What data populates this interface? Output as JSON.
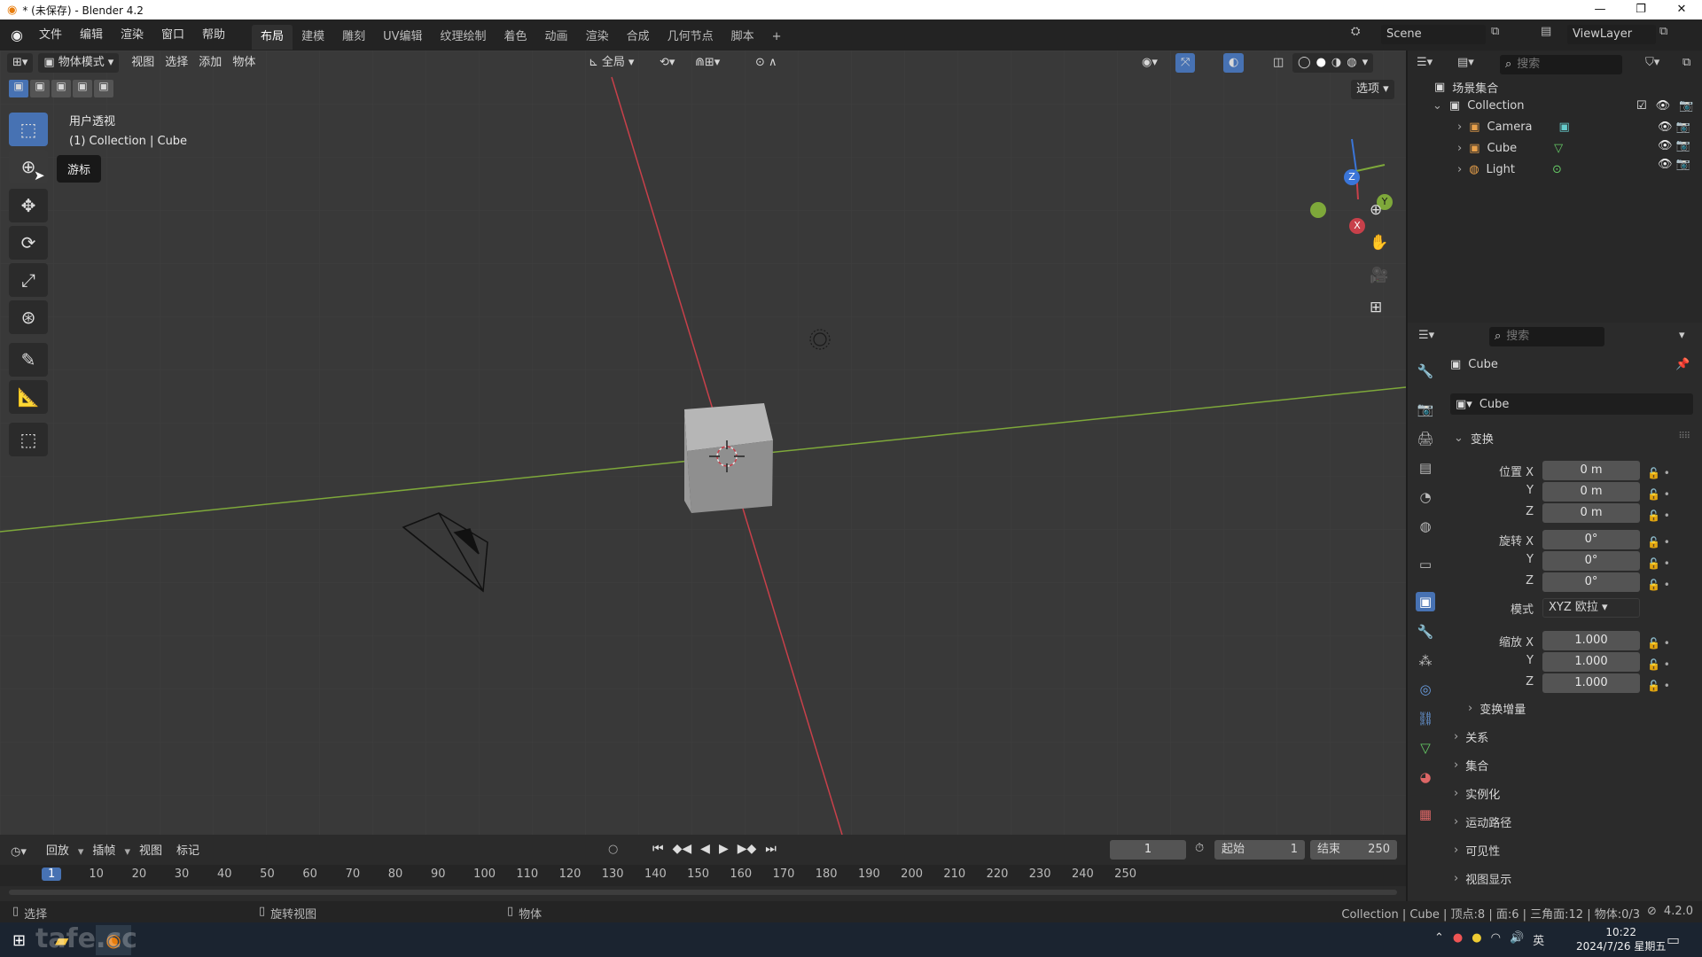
{
  "window": {
    "title": "* (未保存) - Blender 4.2",
    "min": "—",
    "max": "❐",
    "close": "✕"
  },
  "menu": {
    "items": [
      "文件",
      "编辑",
      "渲染",
      "窗口",
      "帮助"
    ]
  },
  "workspaces": {
    "tabs": [
      "布局",
      "建模",
      "雕刻",
      "UV编辑",
      "纹理绘制",
      "着色",
      "动画",
      "渲染",
      "合成",
      "几何节点",
      "脚本"
    ],
    "add": "+"
  },
  "scene": {
    "label": "Scene",
    "view_layer": "ViewLayer"
  },
  "viewport": {
    "mode": "物体模式",
    "menus": [
      "视图",
      "选择",
      "添加",
      "物体"
    ],
    "transform_orientation": "全局",
    "options": "选项",
    "overlay_title": "用户透视",
    "overlay_sub": "(1) Collection | Cube",
    "tooltip": "游标",
    "gizmo": {
      "x": "X",
      "y": "Y",
      "z": "Z"
    }
  },
  "outliner": {
    "search_placeholder": "搜索",
    "scene_collection": "场景集合",
    "collection": "Collection",
    "items": [
      "Camera",
      "Cube",
      "Light"
    ]
  },
  "properties": {
    "search_placeholder": "搜索",
    "object_name": "Cube",
    "object_field": "Cube",
    "transform_header": "变换",
    "location_label": "位置 X",
    "rotation_label": "旋转 X",
    "scale_label": "缩放 X",
    "y": "Y",
    "z": "Z",
    "loc": [
      "0 m",
      "0 m",
      "0 m"
    ],
    "rot": [
      "0°",
      "0°",
      "0°"
    ],
    "mode_label": "模式",
    "mode_value": "XYZ 欧拉",
    "scale": [
      "1.000",
      "1.000",
      "1.000"
    ],
    "delta": "变换增量",
    "panels": [
      "关系",
      "集合",
      "实例化",
      "运动路径",
      "可见性",
      "视图显示"
    ]
  },
  "timeline": {
    "menus": [
      "回放",
      "插帧",
      "视图",
      "标记"
    ],
    "current_frame": "1",
    "start_label": "起始",
    "start": "1",
    "end_label": "结束",
    "end": "250",
    "ticks": [
      "1",
      "10",
      "20",
      "30",
      "40",
      "50",
      "60",
      "70",
      "80",
      "90",
      "100",
      "110",
      "120",
      "130",
      "140",
      "150",
      "160",
      "170",
      "180",
      "190",
      "200",
      "210",
      "220",
      "230",
      "240",
      "250"
    ]
  },
  "status": {
    "select": "选择",
    "rotate": "旋转视图",
    "object": "物体",
    "info": "Collection | Cube | 顶点:8 | 面:6 | 三角面:12 | 物体:0/3",
    "version": "4.2.0"
  },
  "taskbar": {
    "time": "10:22",
    "date": "2024/7/26 星期五",
    "lang": "英",
    "watermark": "tafe.cc"
  },
  "colors": {
    "x_axis": "#c8404a",
    "y_axis": "#7ea83a",
    "active": "#4772b3"
  }
}
